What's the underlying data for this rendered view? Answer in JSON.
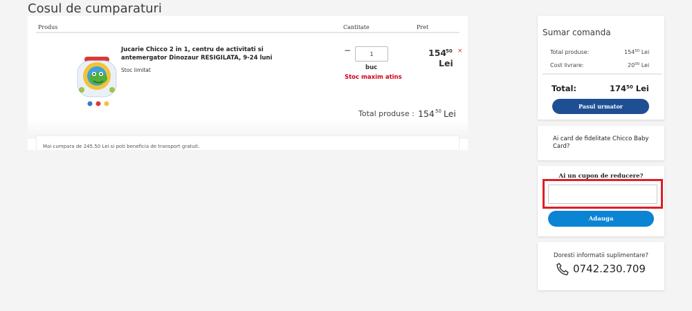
{
  "page": {
    "title": "Cosul de cumparaturi"
  },
  "cart": {
    "headers": {
      "product": "Produs",
      "quantity": "Cantitate",
      "price": "Pret"
    },
    "item": {
      "name": "Jucarie Chicco 2 in 1, centru de activitati si antemergator Dinozaur RESIGILATA, 9-24 luni",
      "stock_note": "Stoc limitat",
      "quantity": "1",
      "unit": "buc",
      "stock_warning": "Stoc maxim atins",
      "price_int": "154",
      "price_dec": "50",
      "currency": "Lei",
      "remove_symbol": "×"
    },
    "total": {
      "label": "Total produse :",
      "int": "154",
      "dec": "50",
      "currency": "Lei"
    },
    "shipping_note": "Mai cumpara de 245.50 Lei si poti beneficia de transport gratuit."
  },
  "summary": {
    "title": "Sumar comanda",
    "products_label": "Total produse:",
    "products_int": "154",
    "products_dec": "50",
    "shipping_label": "Cost livrare:",
    "shipping_int": "20",
    "shipping_dec": "00",
    "currency": "Lei",
    "total_label": "Total:",
    "total_int": "174",
    "total_dec": "50",
    "next_button": "Pasul urmator"
  },
  "loyalty": {
    "text": "Ai card de fidelitate Chicco Baby Card?"
  },
  "coupon": {
    "title": "Ai un cupon de reducere?",
    "value": "",
    "add_button": "Adauga"
  },
  "info": {
    "text": "Doresti informatii suplimentare?",
    "phone": "0742.230.709"
  },
  "colors": {
    "primary_button": "#1f4f93",
    "secondary_button": "#0b84d4",
    "warning": "#d0021b",
    "highlight_frame": "#e01e24",
    "background": "#f4f4f4"
  }
}
